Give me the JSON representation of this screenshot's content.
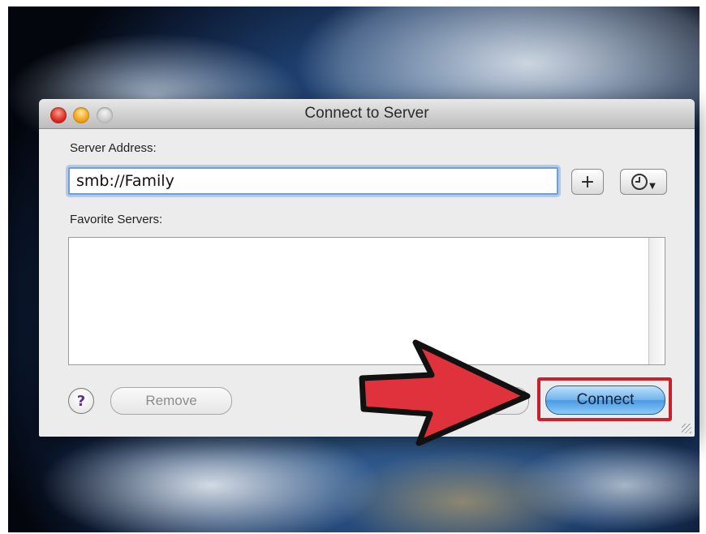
{
  "window": {
    "title": "Connect to Server"
  },
  "server_address": {
    "label": "Server Address:",
    "value": "smb://Family"
  },
  "buttons": {
    "add": "+",
    "help": "?",
    "remove": "Remove",
    "connect": "Connect"
  },
  "favorites": {
    "label": "Favorite Servers:",
    "items": []
  },
  "icons": {
    "recent_servers": "clock-icon",
    "annotation": "red-arrow-icon"
  },
  "colors": {
    "highlight": "#c8202c",
    "arrow_fill": "#e0323c",
    "connect_button": "#6eb3ec"
  }
}
